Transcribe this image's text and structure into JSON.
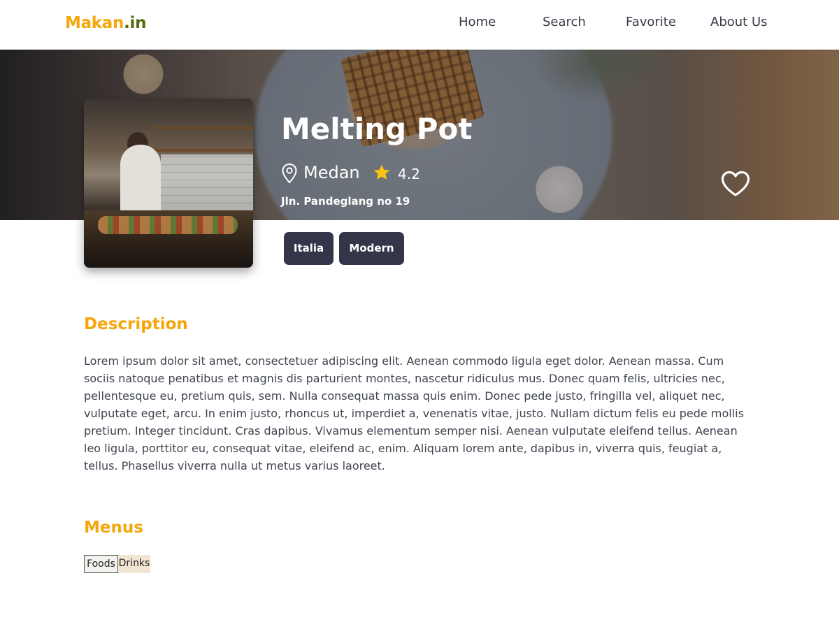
{
  "brand": {
    "part1": "Makan",
    "part2": ".in"
  },
  "nav": {
    "items": [
      "Home",
      "Search",
      "Favorite",
      "About Us"
    ]
  },
  "restaurant": {
    "name": "Melting Pot",
    "city": "Medan",
    "rating": "4.2",
    "address": "Jln. Pandeglang no 19",
    "categories": [
      "Italia",
      "Modern"
    ]
  },
  "description": {
    "heading": "Description",
    "text": "Lorem ipsum dolor sit amet, consectetuer adipiscing elit. Aenean commodo ligula eget dolor. Aenean massa. Cum sociis natoque penatibus et magnis dis parturient montes, nascetur ridiculus mus. Donec quam felis, ultricies nec, pellentesque eu, pretium quis, sem. Nulla consequat massa quis enim. Donec pede justo, fringilla vel, aliquet nec, vulputate eget, arcu. In enim justo, rhoncus ut, imperdiet a, venenatis vitae, justo. Nullam dictum felis eu pede mollis pretium. Integer tincidunt. Cras dapibus. Vivamus elementum semper nisi. Aenean vulputate eleifend tellus. Aenean leo ligula, porttitor eu, consequat vitae, eleifend ac, enim. Aliquam lorem ante, dapibus in, viverra quis, feugiat a, tellus. Phasellus viverra nulla ut metus varius laoreet."
  },
  "menus": {
    "heading": "Menus",
    "tabs": [
      "Foods",
      "Drinks"
    ]
  },
  "colors": {
    "accent": "#f5a60b",
    "brand_suffix": "#556b0f",
    "tag_bg": "#333549"
  },
  "icons": {
    "location": "map-pin-icon",
    "rating": "star-icon",
    "favorite": "heart-icon"
  }
}
